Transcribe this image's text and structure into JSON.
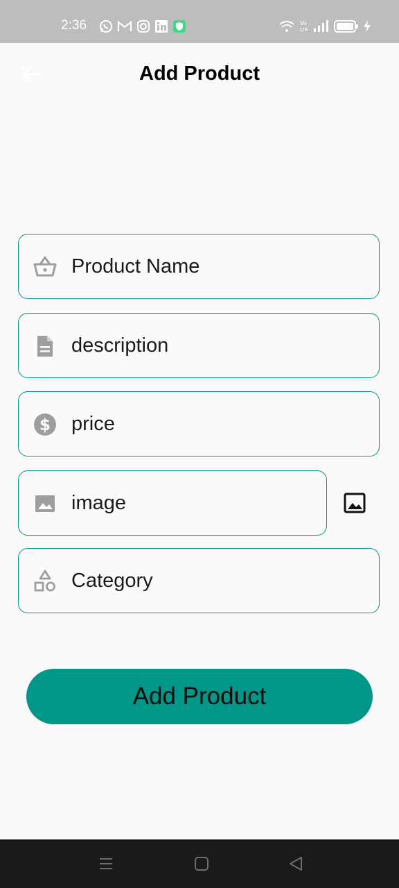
{
  "status_bar": {
    "time": "2:36",
    "left_icons": [
      "whatsapp-icon",
      "gmail-icon",
      "instagram-icon",
      "linkedin-icon",
      "security-app-icon"
    ],
    "right_icons": [
      "wifi-icon",
      "volte-icon",
      "signal-icon",
      "battery-icon",
      "charging-icon"
    ]
  },
  "app_bar": {
    "title": "Add Product",
    "back_icon": "arrow-back-icon"
  },
  "form": {
    "fields": [
      {
        "icon": "basket-icon",
        "label": "Product Name"
      },
      {
        "icon": "document-icon",
        "label": "description"
      },
      {
        "icon": "dollar-icon",
        "label": "price"
      },
      {
        "icon": "image-icon",
        "label": "image"
      },
      {
        "icon": "category-icon",
        "label": "Category"
      }
    ],
    "image_picker_icon": "image-picker-icon",
    "submit_label": "Add Product"
  },
  "nav_bar": {
    "icons": [
      "menu-icon",
      "home-icon",
      "back-icon"
    ]
  },
  "colors": {
    "accent": "#009688",
    "status_bar": "#bdbdbd",
    "background": "#fafafa",
    "nav_bar": "#1a1a1a",
    "icon_grey": "#9e9e9e"
  }
}
